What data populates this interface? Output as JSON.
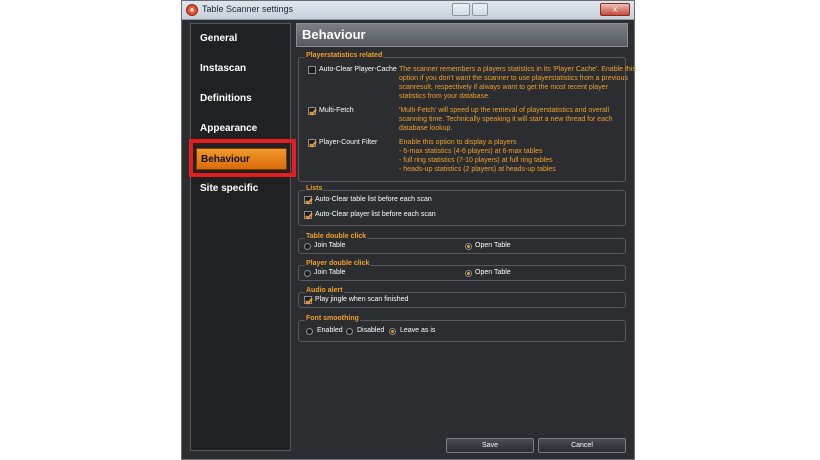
{
  "window": {
    "title": "Table Scanner settings",
    "close_glyph": "x"
  },
  "sidebar": {
    "items": [
      {
        "label": "General"
      },
      {
        "label": "Instascan"
      },
      {
        "label": "Definitions"
      },
      {
        "label": "Appearance"
      },
      {
        "label": "Behaviour"
      },
      {
        "label": "Site specific"
      }
    ],
    "selected": "Behaviour"
  },
  "main": {
    "title": "Behaviour",
    "player_statistics": {
      "legend": "Playerstatistics related",
      "options": [
        {
          "label": "Auto-Clear Player-Cache",
          "checked": false,
          "description": [
            "The scanner remembers a players statistics in its 'Player Cache'. Enable this",
            "option if you don't want the scanner to use playerstatistics from a previous",
            "scanresult, respectively if always want to get the most recent player",
            "statistics from your database."
          ]
        },
        {
          "label": "Multi-Fetch",
          "checked": true,
          "description": [
            "'Multi-Fetch' will speed up the retrieval of playerstatistics and overall",
            "scanning time. Technically speaking it will start a new thread for each",
            "database lookup."
          ]
        },
        {
          "label": "Player-Count Filter",
          "checked": true,
          "description": [
            "Enable this option to display a players",
            "- 6-max statistics (4-6 players) at 6-max tables",
            "- full ring statistics (7-10 players) at full ring tables",
            "- heads-up statistics (2 players) at heads-up tables"
          ]
        }
      ]
    },
    "lists": {
      "legend": "Lists",
      "options": [
        {
          "label": "Auto-Clear table list before each scan",
          "checked": true
        },
        {
          "label": "Auto-Clear player list before each scan",
          "checked": true
        }
      ]
    },
    "table_double_click": {
      "legend": "Table double click",
      "options": [
        "Join Table",
        "Open Table"
      ],
      "selected": "Open Table"
    },
    "player_double_click": {
      "legend": "Player double click",
      "options": [
        "Join Table",
        "Open Table"
      ],
      "selected": "Open Table"
    },
    "audio_alert": {
      "legend": "Audio alert",
      "option": {
        "label": "Play jingle when scan finished",
        "checked": true
      }
    },
    "font_smoothing": {
      "legend": "Font smoothing",
      "options": [
        "Enabled",
        "Disabled",
        "Leave as is"
      ],
      "selected": "Leave as is"
    }
  },
  "footer": {
    "save_label": "Save",
    "cancel_label": "Cancel"
  },
  "colors": {
    "accent": "#f0a02a",
    "selected_tab": "#f39a2c",
    "highlight_box": "#e51d1d",
    "background": "#2b2d30"
  }
}
